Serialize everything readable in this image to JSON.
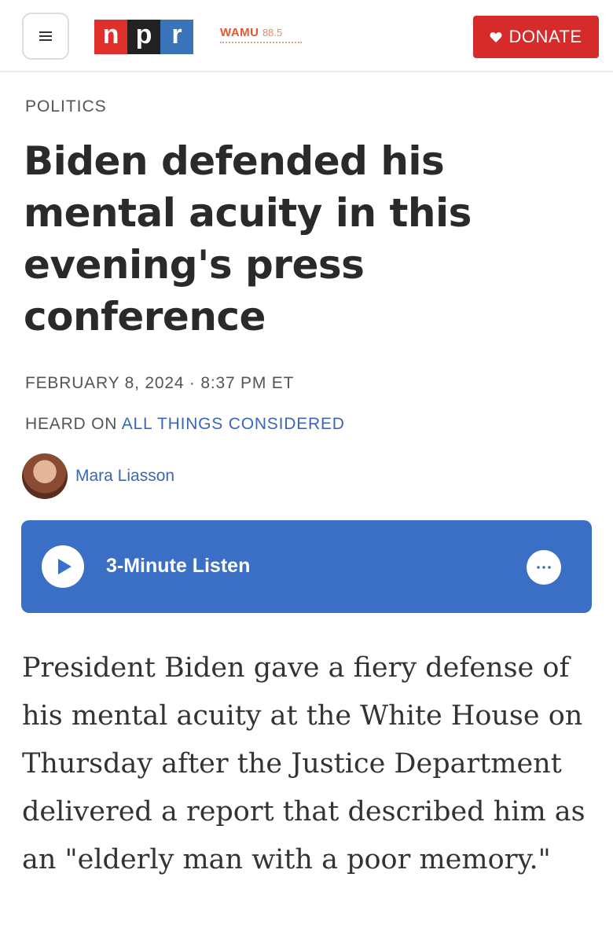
{
  "header": {
    "menu_icon": "hamburger-menu-icon",
    "logo_letters": [
      "n",
      "p",
      "r"
    ],
    "station_name": "WAMU",
    "station_freq": "88.5",
    "donate_label": "DONATE",
    "donate_icon": "heart-icon",
    "colors": {
      "npr_red": "#e0302b",
      "npr_black": "#222222",
      "npr_blue": "#3b73b9",
      "donate_red": "#d52b2b"
    }
  },
  "article": {
    "section": "POLITICS",
    "headline": "Biden defended his mental acuity in this evening's press conference",
    "date": "FEBRUARY 8, 2024 · 8:37 PM ET",
    "heard_on_prefix": "HEARD ON ",
    "heard_on_show": "ALL THINGS CONSIDERED",
    "author": "Mara Liasson",
    "body": "President Biden gave a fiery defense of his mental acuity at the White House on Thursday after the Justice Department delivered a report that described him as an \"elderly man with a poor memory.\""
  },
  "player": {
    "label": "3-Minute Listen",
    "play_icon": "play-icon",
    "more_icon": "more-options-icon",
    "color": "#3a6fc5"
  }
}
